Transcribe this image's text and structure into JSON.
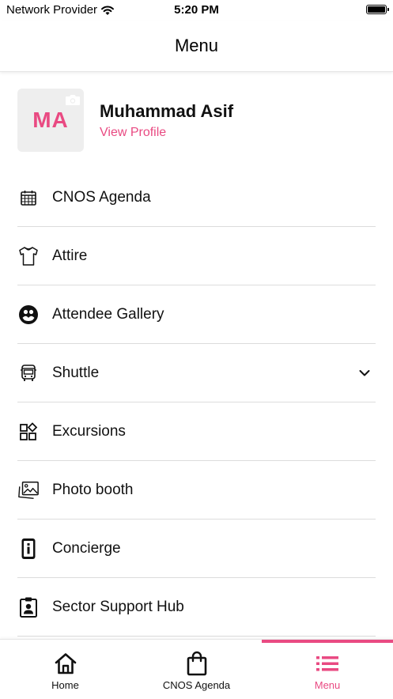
{
  "status_bar": {
    "carrier": "Network Provider",
    "time": "5:20 PM"
  },
  "header": {
    "title": "Menu"
  },
  "profile": {
    "initials": "MA",
    "name": "Muhammad Asif",
    "link": "View Profile"
  },
  "menu": {
    "items": [
      {
        "label": "CNOS Agenda",
        "icon": "calendar-icon"
      },
      {
        "label": "Attire",
        "icon": "shirt-icon"
      },
      {
        "label": "Attendee Gallery",
        "icon": "gallery-icon"
      },
      {
        "label": "Shuttle",
        "icon": "bus-icon",
        "expandable": true
      },
      {
        "label": "Excursions",
        "icon": "grid-icon"
      },
      {
        "label": "Photo booth",
        "icon": "photos-icon"
      },
      {
        "label": "Concierge",
        "icon": "info-icon"
      },
      {
        "label": "Sector Support Hub",
        "icon": "badge-icon"
      }
    ]
  },
  "tabs": {
    "items": [
      {
        "label": "Home",
        "icon": "home-icon"
      },
      {
        "label": "CNOS Agenda",
        "icon": "bag-icon"
      },
      {
        "label": "Menu",
        "icon": "list-icon",
        "active": true
      }
    ]
  },
  "colors": {
    "accent": "#e94a82",
    "text": "#111111",
    "avatar_bg": "#eeeeee",
    "divider": "#dcdcdc"
  }
}
